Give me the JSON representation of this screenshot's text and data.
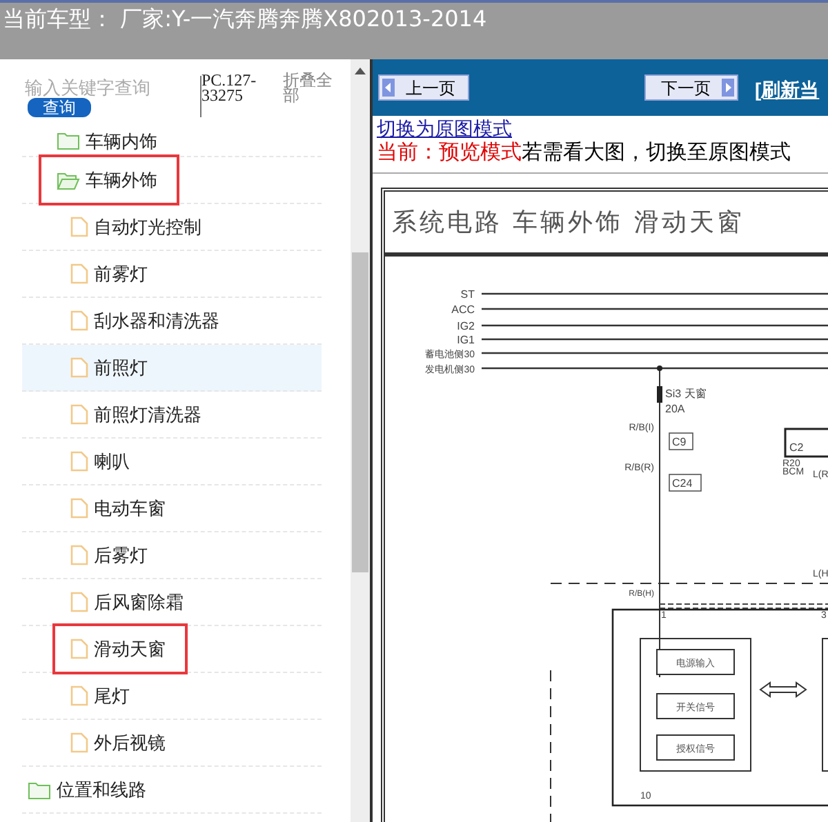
{
  "top_bar": {
    "title": "当前车型： 厂家:Y-一汽奔腾奔腾X802013-2014"
  },
  "search": {
    "placeholder": "输入关键字查询",
    "button": "查询",
    "code": "PC.127-33275",
    "collapse_all": "折叠全部"
  },
  "tree": [
    {
      "children": [
        {
          "label": "车辆内饰",
          "kind": "folder",
          "expanded": false,
          "outlined": false,
          "selected": false
        },
        {
          "label": "车辆外饰",
          "kind": "folder",
          "expanded": true,
          "outlined": true,
          "selected": false,
          "children": [
            {
              "label": "自动灯光控制",
              "kind": "page",
              "outlined": false,
              "selected": false
            },
            {
              "label": "前雾灯",
              "kind": "page",
              "outlined": false,
              "selected": false
            },
            {
              "label": "刮水器和清洗器",
              "kind": "page",
              "outlined": false,
              "selected": false
            },
            {
              "label": "前照灯",
              "kind": "page",
              "outlined": false,
              "selected": true
            },
            {
              "label": "前照灯清洗器",
              "kind": "page",
              "outlined": false,
              "selected": false
            },
            {
              "label": "喇叭",
              "kind": "page",
              "outlined": false,
              "selected": false
            },
            {
              "label": "电动车窗",
              "kind": "page",
              "outlined": false,
              "selected": false
            },
            {
              "label": "后雾灯",
              "kind": "page",
              "outlined": false,
              "selected": false
            },
            {
              "label": "后风窗除霜",
              "kind": "page",
              "outlined": false,
              "selected": false
            },
            {
              "label": "滑动天窗",
              "kind": "page",
              "outlined": true,
              "selected": false
            },
            {
              "label": "尾灯",
              "kind": "page",
              "outlined": false,
              "selected": false
            },
            {
              "label": "外后视镜",
              "kind": "page",
              "outlined": false,
              "selected": false
            }
          ]
        }
      ]
    },
    {
      "label": "位置和线路",
      "kind": "folder",
      "expanded": false,
      "outlined": false,
      "selected": false
    }
  ],
  "viewer": {
    "prev_button": "上一页",
    "next_button": "下一页",
    "refresh_link": "[刷新当",
    "mode_link": "切换为原图模式",
    "mode_status": "当前：预览模式",
    "mode_hint": "若需看大图，切换至原图模式"
  },
  "diagram": {
    "title": "系统电路 车辆外饰 滑动天窗",
    "rails": [
      "ST",
      "ACC",
      "IG2",
      "IG1",
      "蓄电池侧30",
      "发电机侧30"
    ],
    "labels": [
      "Si3 天窗",
      "20A",
      "R/B(I)",
      "C9",
      "R/B(R)",
      "C24",
      "R/B(H)",
      "C2",
      "R20",
      "BCM",
      "L(R",
      "L(H",
      "1",
      "3",
      "10"
    ],
    "blocks": [
      "电源输入",
      "开关信号",
      "授权信号"
    ]
  }
}
